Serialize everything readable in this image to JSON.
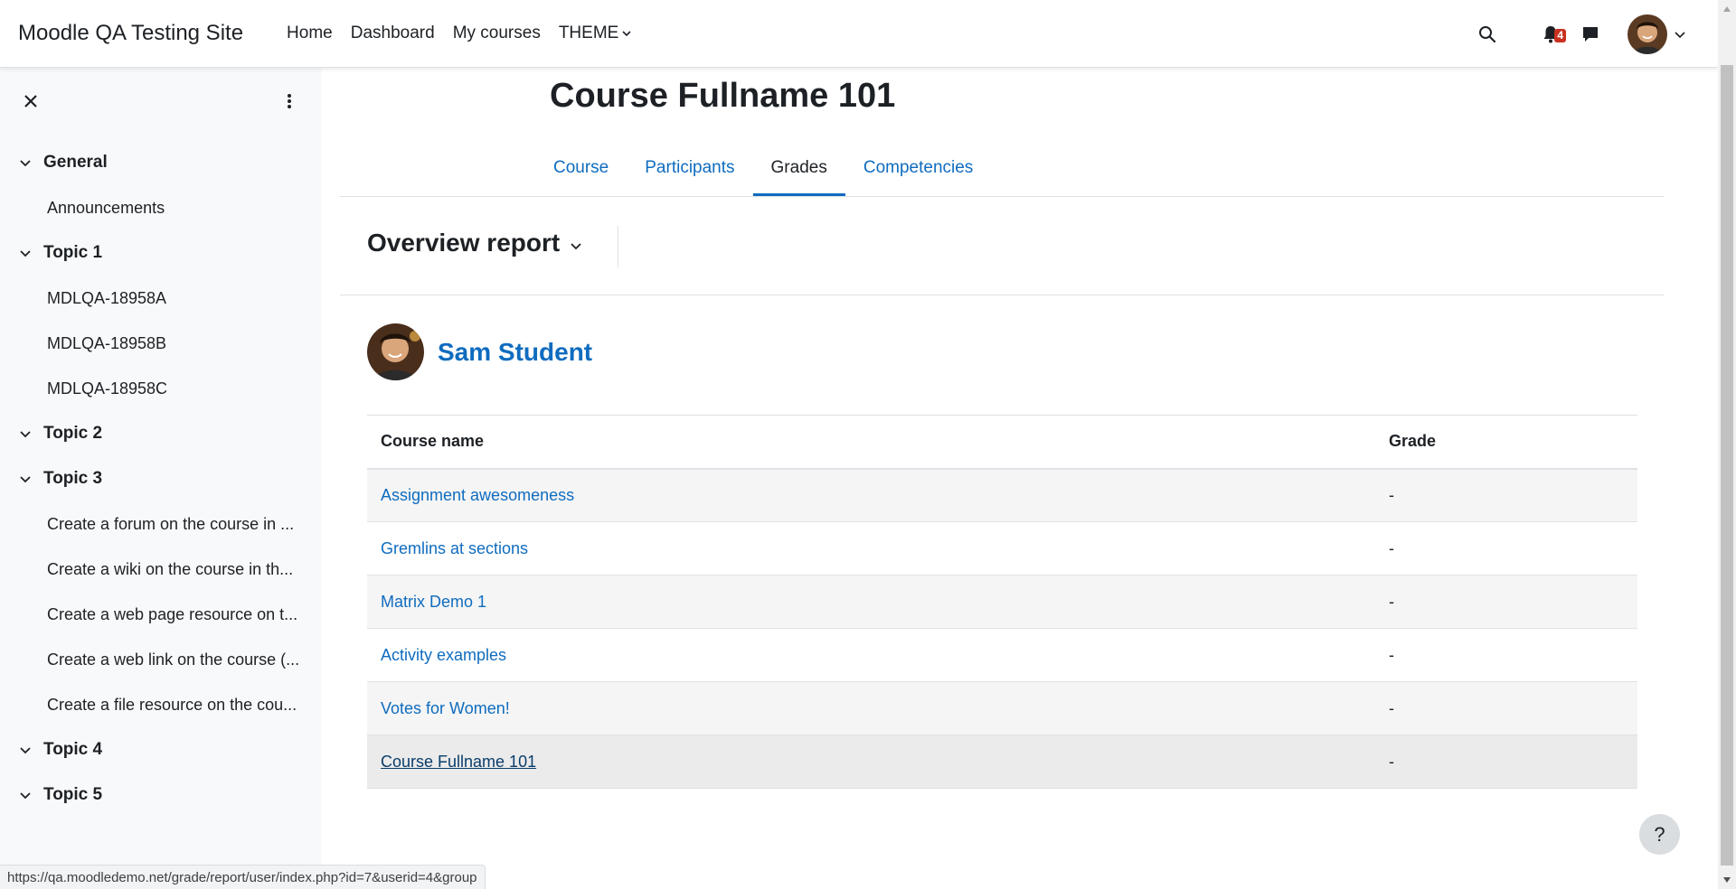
{
  "navbar": {
    "brand": "Moodle QA Testing Site",
    "links": [
      "Home",
      "Dashboard",
      "My courses",
      "THEME"
    ],
    "notification_count": "4"
  },
  "sidebar": {
    "sections": [
      {
        "title": "General",
        "items": [
          "Announcements"
        ]
      },
      {
        "title": "Topic 1",
        "items": [
          "MDLQA-18958A",
          "MDLQA-18958B",
          "MDLQA-18958C"
        ]
      },
      {
        "title": "Topic 2",
        "items": []
      },
      {
        "title": "Topic 3",
        "items": [
          "Create a forum on the course in ...",
          "Create a wiki on the course in th...",
          "Create a web page resource on t...",
          "Create a web link on the course (...",
          "Create a file resource on the cou..."
        ]
      },
      {
        "title": "Topic 4",
        "items": []
      },
      {
        "title": "Topic 5",
        "items": []
      }
    ]
  },
  "main": {
    "page_title": "Course Fullname 101",
    "tabs": [
      "Course",
      "Participants",
      "Grades",
      "Competencies"
    ],
    "active_tab": "Grades",
    "report_title": "Overview report",
    "user_name": "Sam Student",
    "table": {
      "headers": [
        "Course name",
        "Grade"
      ],
      "rows": [
        {
          "course": "Assignment awesomeness",
          "grade": "-"
        },
        {
          "course": "Gremlins at sections",
          "grade": "-"
        },
        {
          "course": "Matrix Demo 1",
          "grade": "-"
        },
        {
          "course": "Activity examples",
          "grade": "-"
        },
        {
          "course": "Votes for Women!",
          "grade": "-"
        },
        {
          "course": "Course Fullname 101",
          "grade": "-"
        }
      ]
    }
  },
  "help": {
    "label": "?"
  },
  "status_bar": {
    "url": "https://qa.moodledemo.net/grade/report/user/index.php?id=7&userid=4&group"
  },
  "colors": {
    "link": "#0f6cbf",
    "badge": "#ca3120",
    "sidebar_bg": "#f8f9fa"
  }
}
